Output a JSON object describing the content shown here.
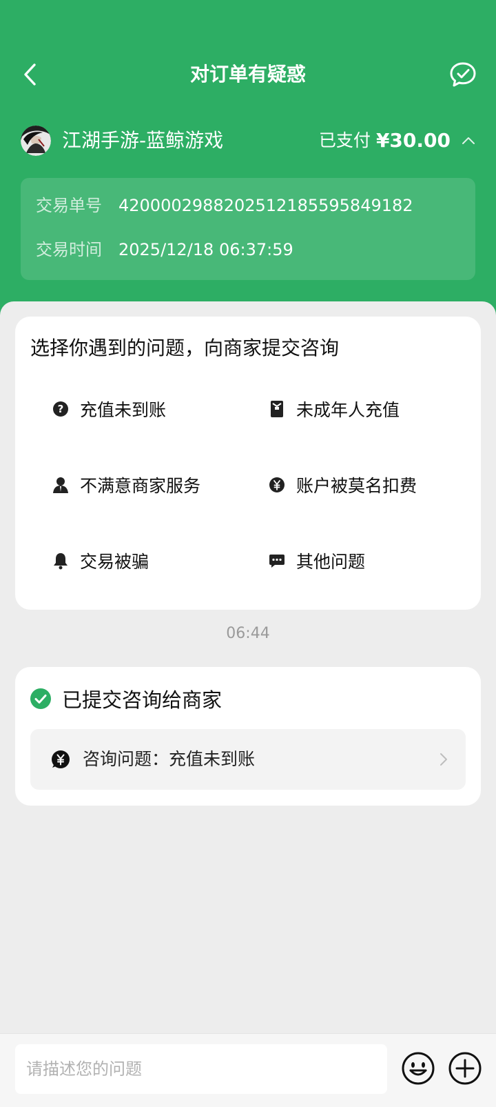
{
  "header": {
    "title": "对订单有疑惑",
    "back_icon": "chevron-left-icon",
    "chat_icon": "chat-check-icon"
  },
  "merchant": {
    "name": "江湖手游-蓝鲸游戏",
    "paid_label": "已支付",
    "amount": "¥30.00"
  },
  "transaction": {
    "order_label": "交易单号",
    "order_number": "4200002988202512185595849182",
    "time_label": "交易时间",
    "time": "2025/12/18 06:37:59"
  },
  "issues": {
    "title": "选择你遇到的问题，向商家提交咨询",
    "items": [
      {
        "label": "充值未到账",
        "icon": "question-circle-icon"
      },
      {
        "label": "未成年人充值",
        "icon": "id-badge-icon"
      },
      {
        "label": "不满意商家服务",
        "icon": "person-icon"
      },
      {
        "label": "账户被莫名扣费",
        "icon": "yuan-circle-icon"
      },
      {
        "label": "交易被骗",
        "icon": "bell-icon"
      },
      {
        "label": "其他问题",
        "icon": "message-dots-icon"
      }
    ]
  },
  "timestamp": "06:44",
  "submitted": {
    "title": "已提交咨询给商家",
    "question": "咨询问题：充值未到账"
  },
  "input_bar": {
    "placeholder": "请描述您的问题"
  },
  "colors": {
    "brand_green": "#2DAE64",
    "background": "#EDEDED"
  }
}
